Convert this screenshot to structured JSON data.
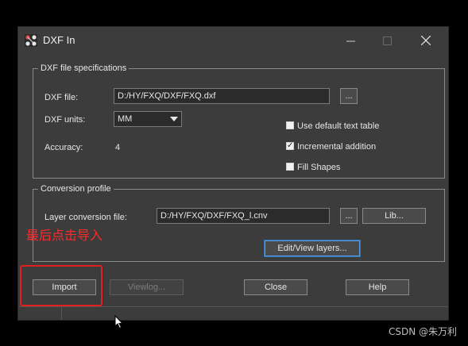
{
  "window": {
    "title": "DXF In"
  },
  "dxf_specs": {
    "group_title": "DXF file specifications",
    "file_label": "DXF file:",
    "file_value": "D:/HY/FXQ/DXF/FXQ.dxf",
    "browse_label": "...",
    "units_label": "DXF units:",
    "units_value": "MM",
    "accuracy_label": "Accuracy:",
    "accuracy_value": "4",
    "options": [
      {
        "label": "Use default text table",
        "checked": false
      },
      {
        "label": "Incremental addition",
        "checked": true
      },
      {
        "label": "Fill Shapes",
        "checked": false
      }
    ]
  },
  "conversion": {
    "group_title": "Conversion profile",
    "layer_file_label": "Layer conversion file:",
    "layer_file_value": "D:/HY/FXQ/DXF/FXQ_l.cnv",
    "browse_label": "...",
    "lib_label": "Lib...",
    "edit_layers_label": "Edit/View layers..."
  },
  "buttons": {
    "import": "Import",
    "viewlog": "Viewlog...",
    "close": "Close",
    "help": "Help"
  },
  "annotation": {
    "text": "最后点击导入",
    "color": "#ff2a2a"
  },
  "watermark": "CSDN @朱万利",
  "colors": {
    "window_bg": "#3c3c3c",
    "focus_border": "#5aa0e6"
  }
}
